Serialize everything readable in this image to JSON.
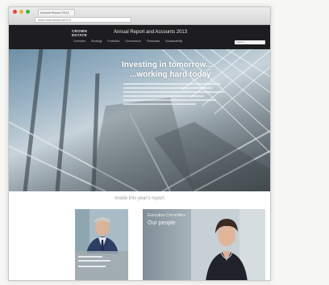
{
  "browser": {
    "tab_title": "Annual Report 2013",
    "address": "www.annualreport2013",
    "traffic_lights": [
      "#e2463a",
      "#e8b135",
      "#3fb44a"
    ]
  },
  "site": {
    "logo": "CROWN ESTATE",
    "title": "Annual Report and Accounts 2013",
    "nav": [
      "Overview",
      "Strategy",
      "Portfolios",
      "Governance",
      "Financials",
      "Sustainability"
    ],
    "search_placeholder": "Search"
  },
  "hero": {
    "line1": "Investing in tomorrow...",
    "line2": "...working hard today"
  },
  "content": {
    "section_title": "Inside this year's report",
    "card2_caption_small": "Executive Committee",
    "card2_caption_large": "Our people"
  },
  "colors": {
    "header_bg": "#1d1d1f",
    "hero_text": "#ffffff"
  }
}
